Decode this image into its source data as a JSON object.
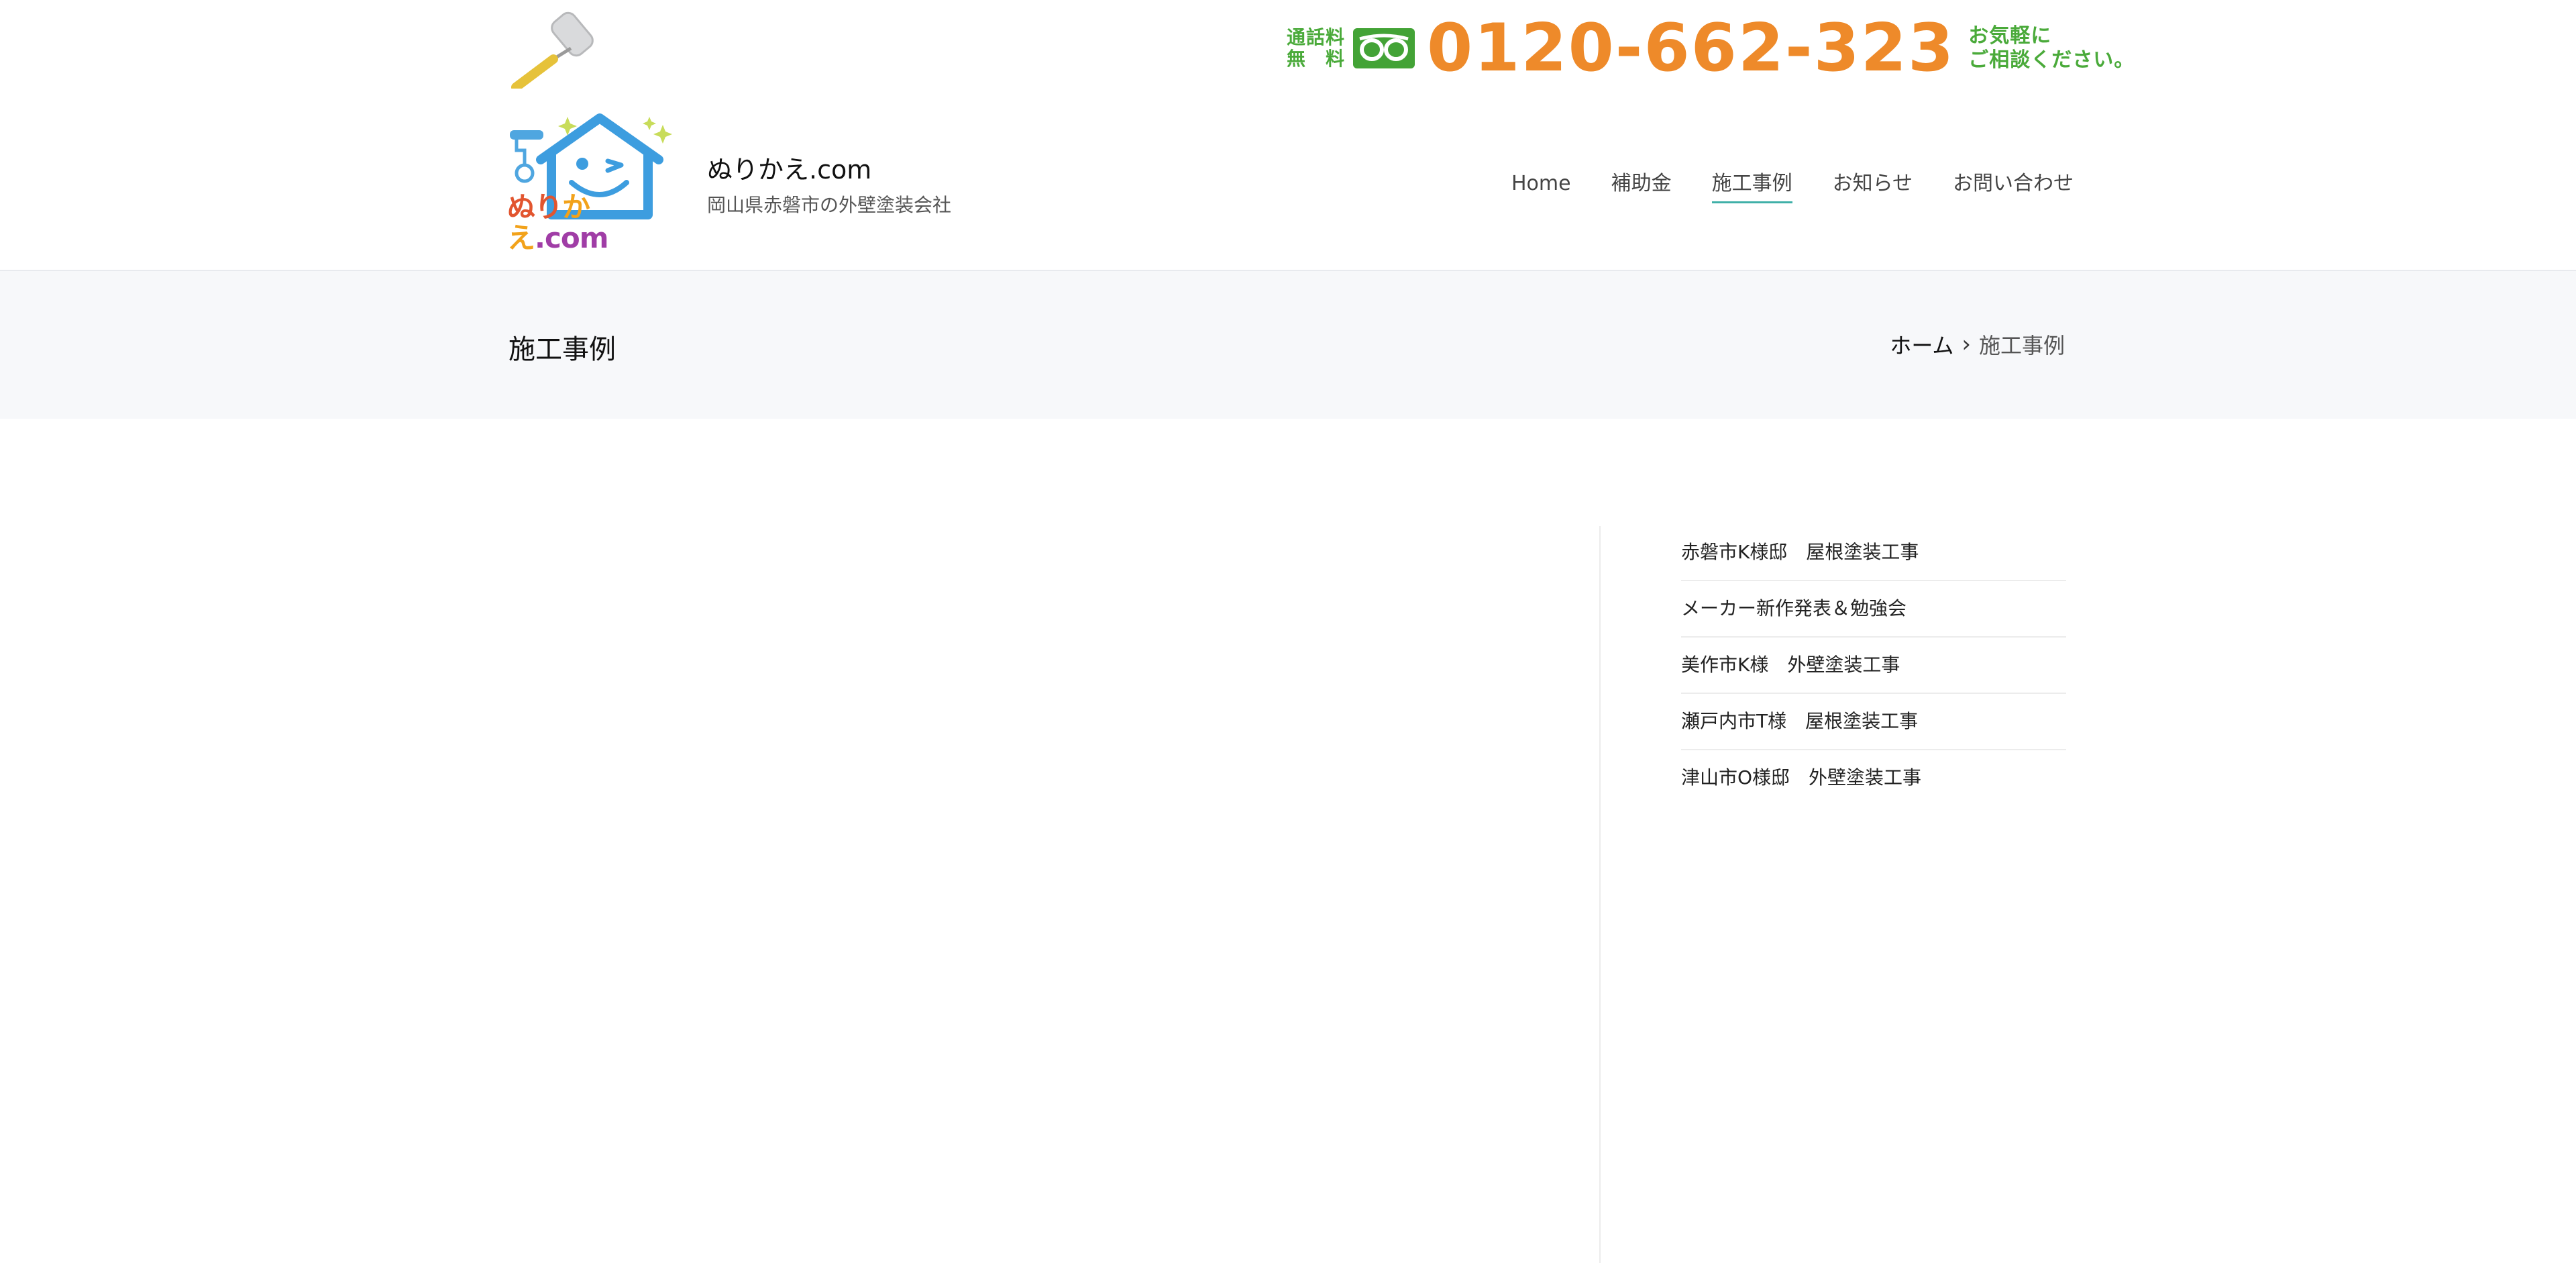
{
  "header": {
    "phone": {
      "free_label_top": "通話料",
      "free_label_bottom": "無　料",
      "number": "0120-662-323",
      "cta_line1": "お気軽に",
      "cta_line2": "ご相談ください。"
    },
    "logo_text": {
      "part1": "ぬり",
      "part2": "かえ",
      "part3": ".com"
    },
    "site_title": "ぬりかえ.com",
    "tagline": "岡山県赤磐市の外壁塗装会社"
  },
  "nav": {
    "items": [
      {
        "label": "Home"
      },
      {
        "label": "補助金"
      },
      {
        "label": "施工事例"
      },
      {
        "label": "お知らせ"
      },
      {
        "label": "お問い合わせ"
      }
    ]
  },
  "page": {
    "title": "施工事例",
    "breadcrumb": {
      "home": "ホーム",
      "separator": "›",
      "current": "施工事例"
    }
  },
  "sidebar": {
    "recent_posts": [
      {
        "title": "赤磐市K様邸　屋根塗装工事"
      },
      {
        "title": "メーカー新作発表＆勉強会"
      },
      {
        "title": "美作市K様　外壁塗装工事"
      },
      {
        "title": "瀬戸内市T様　屋根塗装工事"
      },
      {
        "title": "津山市O様邸　外壁塗装工事"
      }
    ]
  },
  "colors": {
    "phone_orange": "#ee8a2a",
    "phone_green": "#4aaa3a",
    "logo_blue": "#3d9ddf",
    "nav_active_underline": "#3fb0a8"
  }
}
